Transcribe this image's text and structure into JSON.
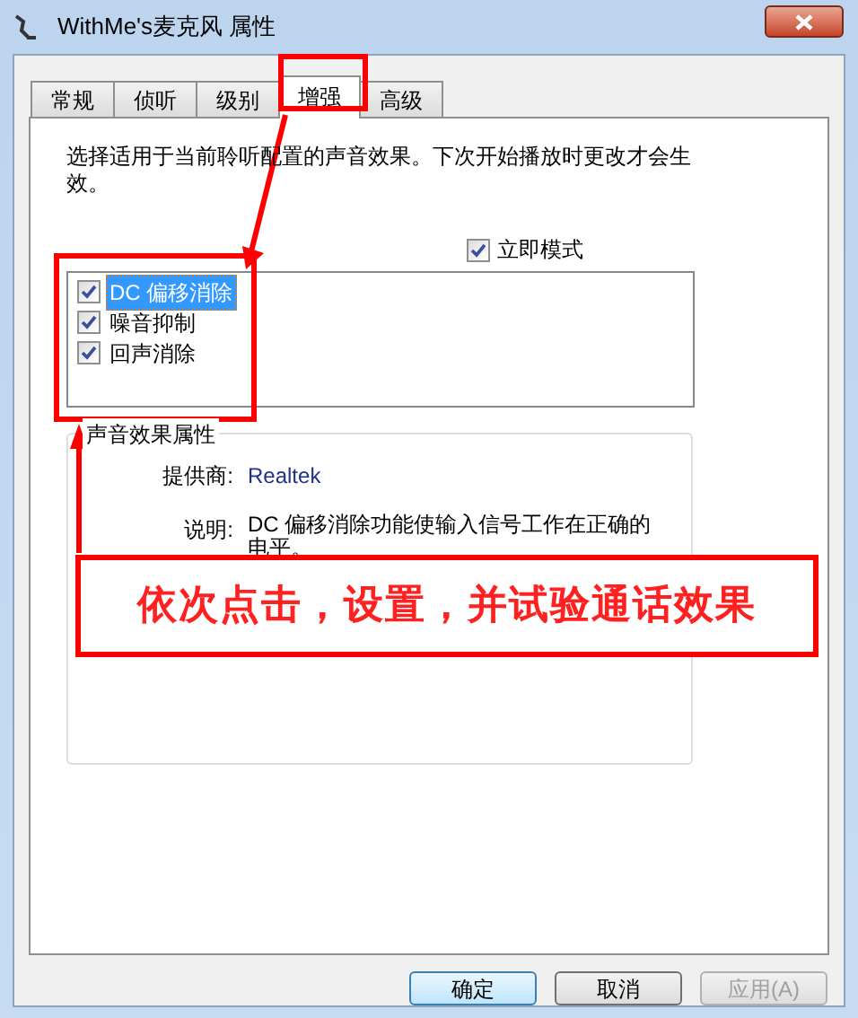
{
  "window": {
    "title": "WithMe's麦克风 属性"
  },
  "tabs": [
    {
      "label": "常规",
      "selected": false
    },
    {
      "label": "侦听",
      "selected": false
    },
    {
      "label": "级别",
      "selected": false
    },
    {
      "label": "增强",
      "selected": true
    },
    {
      "label": "高级",
      "selected": false
    }
  ],
  "intro": "选择适用于当前聆听配置的声音效果。下次开始播放时更改才会生效。",
  "immediate_mode": {
    "label": "立即模式",
    "checked": true
  },
  "effects": [
    {
      "label": "DC 偏移消除",
      "checked": true,
      "selected": true
    },
    {
      "label": "噪音抑制",
      "checked": true,
      "selected": false
    },
    {
      "label": "回声消除",
      "checked": true,
      "selected": false
    }
  ],
  "properties": {
    "title": "声音效果属性",
    "provider_label": "提供商:",
    "provider": "Realtek",
    "description_label": "说明:",
    "description": "DC 偏移消除功能使输入信号工作在正确的电平。"
  },
  "buttons": [
    {
      "label": "确定",
      "disabled": false,
      "default": true
    },
    {
      "label": "取消",
      "disabled": false,
      "default": false
    },
    {
      "label": "应用(A)",
      "disabled": true,
      "default": false
    }
  ],
  "annotation": {
    "caption": "依次点击，设置，并试验通话效果"
  }
}
